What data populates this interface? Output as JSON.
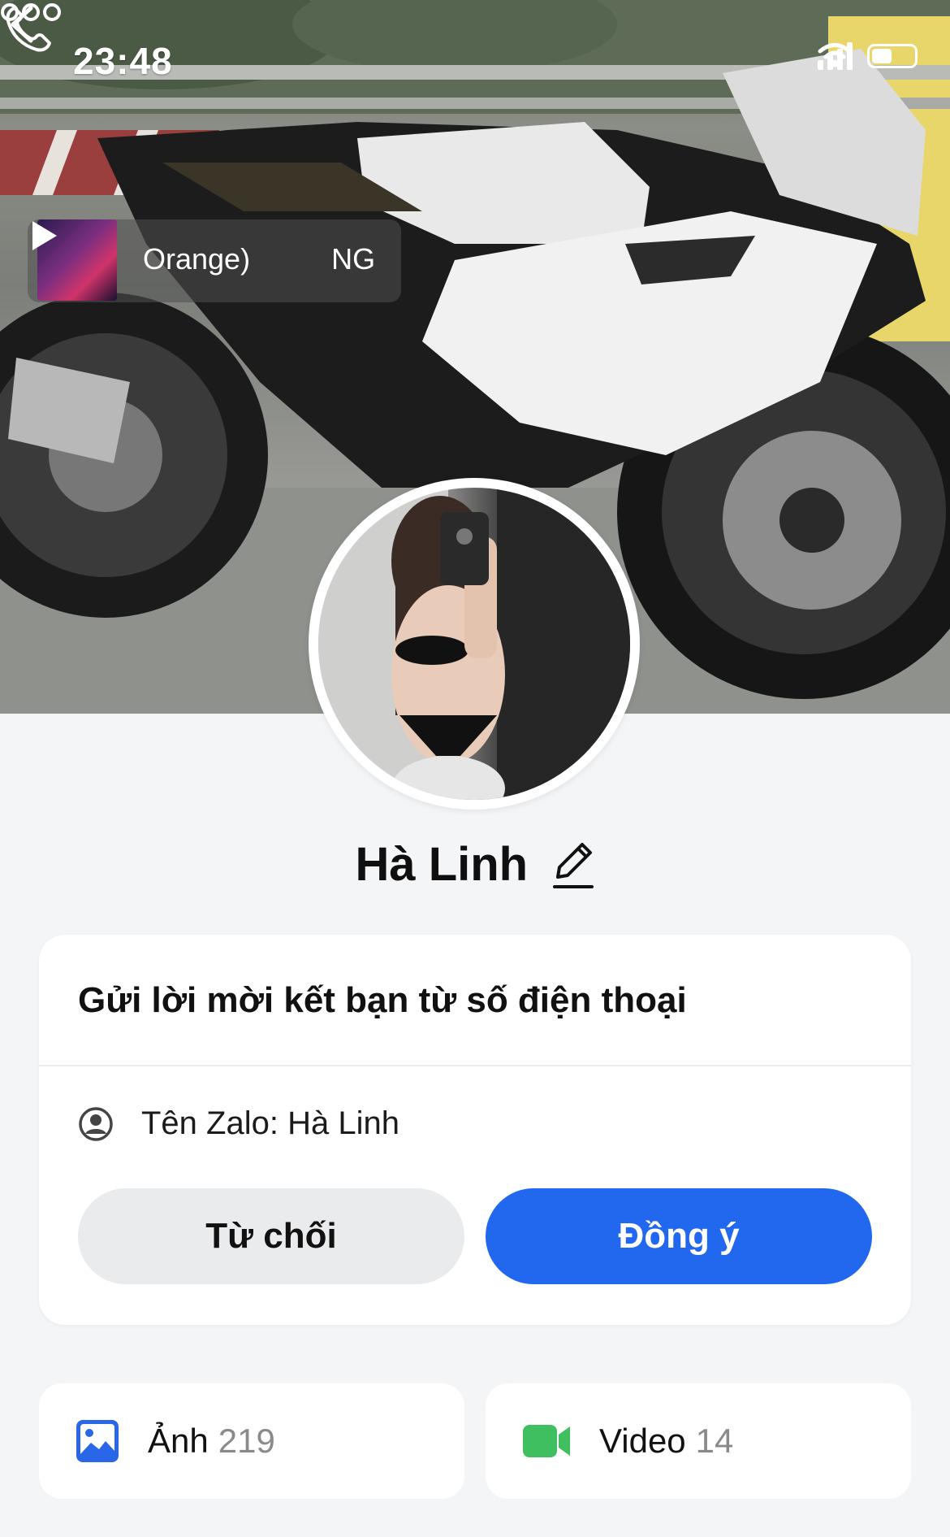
{
  "status_bar": {
    "time": "23:48"
  },
  "header": {
    "music": {
      "title_part1": "Orange)",
      "title_part2": "NG"
    }
  },
  "profile": {
    "name": "Hà Linh"
  },
  "friend_request": {
    "title": "Gửi lời mời kết bạn từ số điện thoại",
    "zalo_name_label": "Tên Zalo: Hà Linh",
    "decline_label": "Từ chối",
    "accept_label": "Đồng ý"
  },
  "media": {
    "photos": {
      "label": "Ảnh",
      "count": "219"
    },
    "videos": {
      "label": "Video",
      "count": "14"
    }
  },
  "colors": {
    "accent": "#2268ef",
    "decline_bg": "#eaebed",
    "photo_icon": "#2a67e8",
    "video_icon": "#3fbf5f",
    "page_bg": "#f4f5f7"
  },
  "icons": [
    "back-icon",
    "phone-icon",
    "more-icon",
    "play-icon",
    "edit-icon",
    "user-circle-icon",
    "image-icon",
    "video-icon"
  ]
}
